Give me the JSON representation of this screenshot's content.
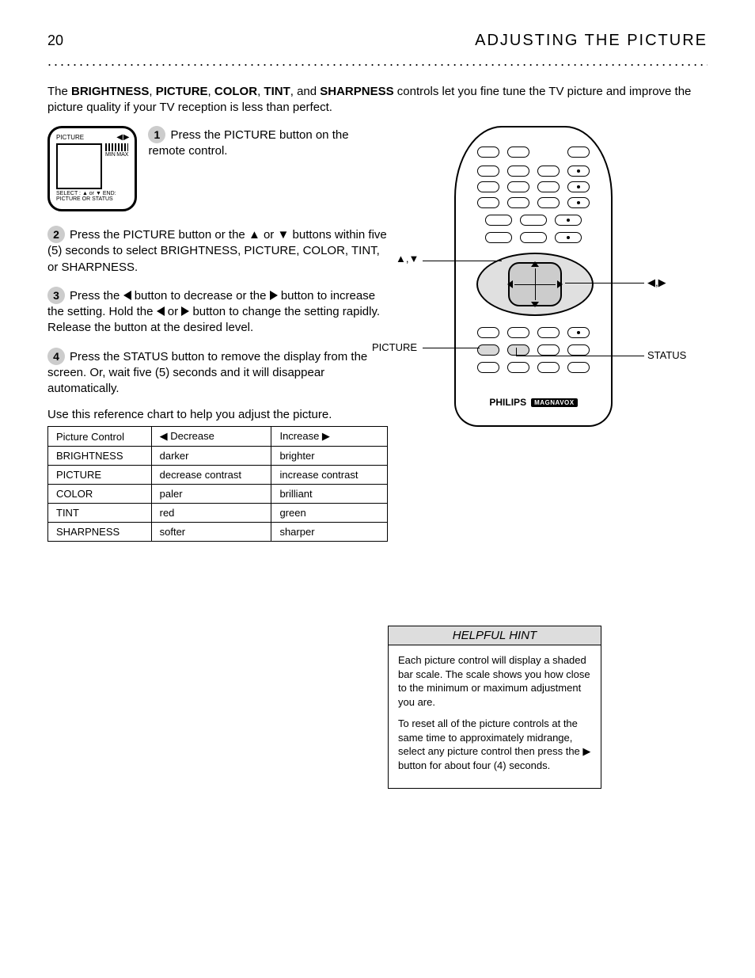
{
  "header": {
    "page_number": "20",
    "title": "ADJUSTING THE PICTURE"
  },
  "intro_html": "The <b>BRIGHTNESS</b>, <b>PICTURE</b>, <b>COLOR</b>, <b>TINT</b>, and <b>SHARPNESS</b> controls let you fine tune the TV picture and improve the picture quality if your TV reception is less than perfect.",
  "tv_osd": {
    "picture_label": "PICTURE",
    "min": "MIN",
    "max": "MAX",
    "bottom_hint": "SELECT : ▲ or ▼    END: PICTURE OR STATUS"
  },
  "steps": {
    "s1": "Press the PICTURE button on the remote control.",
    "s2_a": "Press the PICTURE button or the ",
    "s2_b": " or ",
    "s2_c": " buttons within five (5) seconds to select BRIGHTNESS, PICTURE, COLOR, TINT, or SHARPNESS.",
    "s3_a": "Press the ",
    "s3_b": " button to decrease or the ",
    "s3_c": " button to increase the setting. Hold the ",
    "s3_d": " or ",
    "s3_e": " button to change the setting rapidly. Release the button at the desired level.",
    "s4": "Press the STATUS button to remove the display from the screen. Or, wait five (5) seconds and it will disappear automatically."
  },
  "table": {
    "caption": "Use this reference chart to help you adjust the picture.",
    "headers": [
      "Picture Control",
      "◀ Decrease",
      "Increase ▶"
    ],
    "rows": [
      [
        "BRIGHTNESS",
        "darker",
        "brighter"
      ],
      [
        "PICTURE",
        "decrease contrast",
        "increase contrast"
      ],
      [
        "COLOR",
        "paler",
        "brilliant"
      ],
      [
        "TINT",
        "red",
        "green"
      ],
      [
        "SHARPNESS",
        "softer",
        "sharper"
      ]
    ]
  },
  "remote": {
    "brand": "PHILIPS",
    "badge": "MAGNAVOX",
    "callouts": {
      "up_dn": "▲,▼",
      "lf_rt": "◀,▶",
      "picture": "PICTURE",
      "status": "STATUS"
    }
  },
  "help": {
    "title": "HELPFUL HINT",
    "p1": "Each picture control will display a shaded bar scale. The scale shows you how close to the minimum or maximum adjustment you are.",
    "p2": "To reset all of the picture controls at the same time to approximately midrange, select any picture control then press the ▶ button for about four (4) seconds."
  }
}
